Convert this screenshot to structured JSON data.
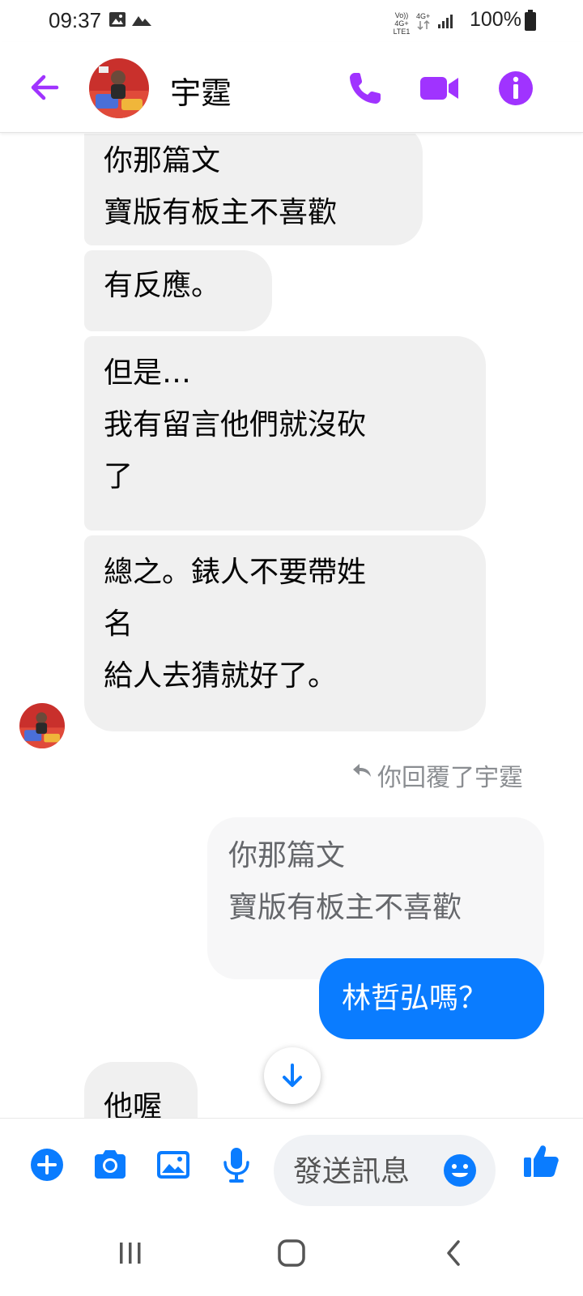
{
  "status_bar": {
    "time": "09:37",
    "network_top": "Vo)) 4G+",
    "network_bottom": "LTE1",
    "battery": "100%"
  },
  "header": {
    "contact_name": "宇霆",
    "icons": [
      "back-arrow-icon",
      "phone-icon",
      "video-camera-icon",
      "info-icon"
    ],
    "accent_color": "#a033ff"
  },
  "messages": {
    "received": [
      {
        "text": "你那篇文\n寶版有板主不喜歡"
      },
      {
        "text": "有反應。"
      },
      {
        "text": "但是…\n我有留言他們就沒砍\n了"
      },
      {
        "text": "總之。錶人不要帶姓\n名\n給人去猜就好了。"
      }
    ],
    "reply_label": "你回覆了宇霆",
    "quoted_text": "你那篇文\n寶版有板主不喜歡",
    "sent_text": "林哲弘嗎？",
    "partial_received": "他喔"
  },
  "composer": {
    "placeholder": "發送訊息",
    "icons": [
      "plus-icon",
      "camera-icon",
      "gallery-icon",
      "microphone-icon",
      "emoji-icon",
      "thumbs-up-icon"
    ],
    "accent_color": "#0a7cff"
  },
  "navbar": {
    "icons": [
      "recent-apps-icon",
      "home-icon",
      "back-icon"
    ]
  }
}
